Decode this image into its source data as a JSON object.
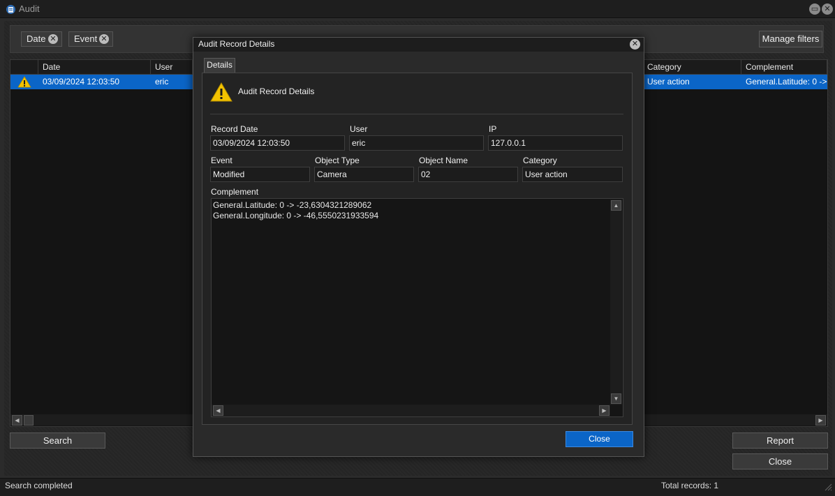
{
  "window": {
    "title": "Audit"
  },
  "filters": {
    "chips": [
      "Date",
      "Event"
    ],
    "manage_label": "Manage filters"
  },
  "grid": {
    "columns": [
      "Date",
      "User",
      "Category",
      "Complement"
    ],
    "row": {
      "date": "03/09/2024 12:03:50",
      "user": "eric",
      "category": "User action",
      "complement": "General.Latitude: 0 ->"
    }
  },
  "buttons": {
    "search": "Search",
    "report": "Report",
    "close": "Close"
  },
  "status": {
    "message": "Search completed",
    "total": "Total records: 1"
  },
  "dialog": {
    "title": "Audit Record Details",
    "tab": "Details",
    "heading": "Audit Record Details",
    "fields": {
      "record_date": {
        "label": "Record Date",
        "value": "03/09/2024 12:03:50"
      },
      "user": {
        "label": "User",
        "value": "eric"
      },
      "ip": {
        "label": "IP",
        "value": "127.0.0.1"
      },
      "event": {
        "label": "Event",
        "value": "Modified"
      },
      "object_type": {
        "label": "Object Type",
        "value": "Camera"
      },
      "object_name": {
        "label": "Object Name",
        "value": "02"
      },
      "category": {
        "label": "Category",
        "value": "User action"
      }
    },
    "complement_label": "Complement",
    "complement_lines": [
      "General.Latitude: 0 -> -23,6304321289062",
      "General.Longitude: 0 -> -46,5550231933594"
    ],
    "close_label": "Close"
  },
  "colors": {
    "selection": "#0b65c7",
    "warning": "#f2c200"
  }
}
